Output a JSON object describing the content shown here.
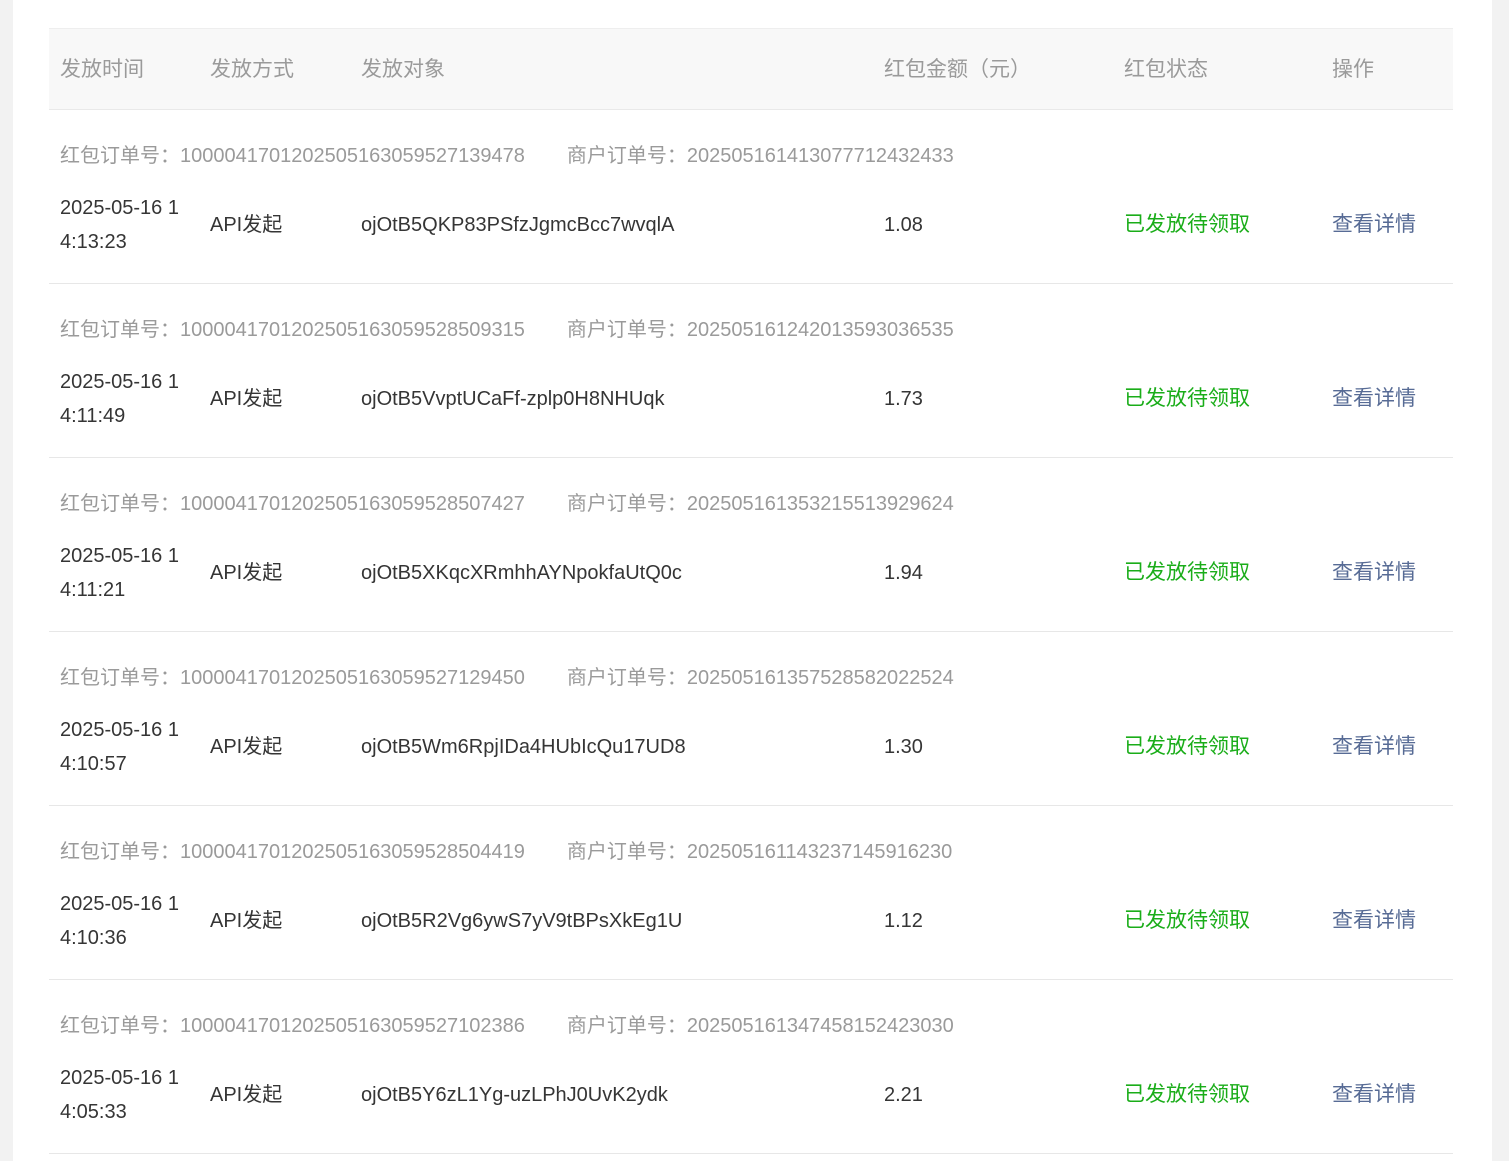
{
  "columns": {
    "time": "发放时间",
    "method": "发放方式",
    "target": "发放对象",
    "amount": "红包金额（元）",
    "status": "红包状态",
    "op": "操作"
  },
  "labels": {
    "redpack_order": "红包订单号：",
    "merchant_order": "商户订单号："
  },
  "rows": [
    {
      "redpack_order_no": "10000417012025051630595271394​78",
      "merchant_order_no": "2025051614130777124324​33",
      "time": "2025-05-16 14:13:23",
      "method": "API发起",
      "target": "ojOtB5QKP83PSfzJgmcBcc7wvqlA",
      "amount": "1.08",
      "status": "已发放待领取",
      "op": "查看详情"
    },
    {
      "redpack_order_no": "1000041701202505163059528509315",
      "merchant_order_no": "2025051612420135930365​35",
      "time": "2025-05-16 14:11:49",
      "method": "API发起",
      "target": "ojOtB5VvptUCaFf-zplp0H8NHUqk",
      "amount": "1.73",
      "status": "已发放待领取",
      "op": "查看详情"
    },
    {
      "redpack_order_no": "1000041701202505163059528507427",
      "merchant_order_no": "202505161353215513929624",
      "time": "2025-05-16 14:11:21",
      "method": "API发起",
      "target": "ojOtB5XKqcXRmhhAYNpokfaUtQ0c",
      "amount": "1.94",
      "status": "已发放待领取",
      "op": "查看详情"
    },
    {
      "redpack_order_no": "1000041701202505163059527129450",
      "merchant_order_no": "202505161357528582022524",
      "time": "2025-05-16 14:10:57",
      "method": "API发起",
      "target": "ojOtB5Wm6RpjIDa4HUbIcQu17UD8",
      "amount": "1.30",
      "status": "已发放待领取",
      "op": "查看详情"
    },
    {
      "redpack_order_no": "1000041701202505163059528504419",
      "merchant_order_no": "202505161143237145916230",
      "time": "2025-05-16 14:10:36",
      "method": "API发起",
      "target": "ojOtB5R2Vg6ywS7yV9tBPsXkEg1U",
      "amount": "1.12",
      "status": "已发放待领取",
      "op": "查看详情"
    },
    {
      "redpack_order_no": "1000041701202505163059527102386",
      "merchant_order_no": "202505161347458152423030",
      "time": "2025-05-16 14:05:33",
      "method": "API发起",
      "target": "ojOtB5Y6zL1Yg-uzLPhJ0UvK2ydk",
      "amount": "2.21",
      "status": "已发放待领取",
      "op": "查看详情"
    }
  ]
}
